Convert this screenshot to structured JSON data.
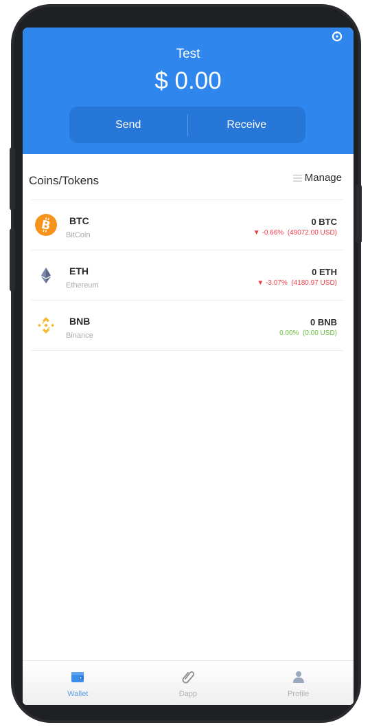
{
  "header": {
    "wallet_name": "Test",
    "balance": "$ 0.00",
    "send_label": "Send",
    "receive_label": "Receive"
  },
  "list": {
    "title": "Coins/Tokens",
    "manage_label": "Manage"
  },
  "coins": [
    {
      "symbol": "BTC",
      "name": "BitCoin",
      "amount": "0 BTC",
      "change": "-0.66%",
      "fiat": "(49072.00 USD)",
      "trend": "down",
      "icon": "bitcoin-icon"
    },
    {
      "symbol": "ETH",
      "name": "Ethereum",
      "amount": "0 ETH",
      "change": "-3.07%",
      "fiat": "(4180.97 USD)",
      "trend": "down",
      "icon": "ethereum-icon"
    },
    {
      "symbol": "BNB",
      "name": "Binance",
      "amount": "0 BNB",
      "change": "0.00%",
      "fiat": "(0.00 USD)",
      "trend": "flat",
      "icon": "binance-icon"
    }
  ],
  "bottom_nav": {
    "items": [
      {
        "label": "Wallet",
        "icon": "wallet-icon",
        "active": true
      },
      {
        "label": "Dapp",
        "icon": "paperclip-icon",
        "active": false
      },
      {
        "label": "Profile",
        "icon": "profile-icon",
        "active": false
      }
    ]
  },
  "colors": {
    "header_blue": "#2f87ee",
    "button_blue": "#2677d7",
    "negative": "#ee3b45",
    "neutral_change": "#6abf3b",
    "btc_orange": "#f7931a",
    "bnb_yellow": "#f3ba2f"
  }
}
